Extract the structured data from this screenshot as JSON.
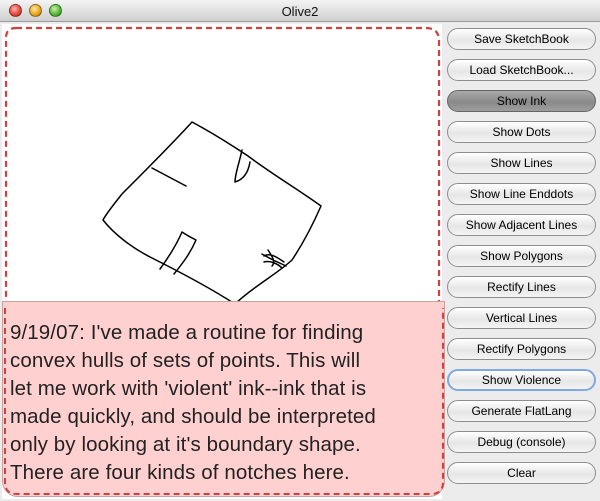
{
  "window": {
    "title": "Olive2"
  },
  "buttons": [
    {
      "label": "Save SketchBook",
      "name": "save-sketchbook-button",
      "state": "normal"
    },
    {
      "label": "Load SketchBook...",
      "name": "load-sketchbook-button",
      "state": "normal"
    },
    {
      "label": "Show Ink",
      "name": "show-ink-button",
      "state": "pressed"
    },
    {
      "label": "Show Dots",
      "name": "show-dots-button",
      "state": "normal"
    },
    {
      "label": "Show Lines",
      "name": "show-lines-button",
      "state": "normal"
    },
    {
      "label": "Show Line Enddots",
      "name": "show-line-enddots-button",
      "state": "normal"
    },
    {
      "label": "Show Adjacent Lines",
      "name": "show-adjacent-lines-button",
      "state": "normal"
    },
    {
      "label": "Show Polygons",
      "name": "show-polygons-button",
      "state": "normal"
    },
    {
      "label": "Rectify Lines",
      "name": "rectify-lines-button",
      "state": "normal"
    },
    {
      "label": "Vertical Lines",
      "name": "vertical-lines-button",
      "state": "normal"
    },
    {
      "label": "Rectify Polygons",
      "name": "rectify-polygons-button",
      "state": "normal"
    },
    {
      "label": "Show Violence",
      "name": "show-violence-button",
      "state": "focused"
    },
    {
      "label": "Generate FlatLang",
      "name": "generate-flatlang-button",
      "state": "normal"
    },
    {
      "label": "Debug (console)",
      "name": "debug-console-button",
      "state": "normal"
    },
    {
      "label": "Clear",
      "name": "clear-button",
      "state": "normal"
    }
  ],
  "note": {
    "lines": [
      "9/19/07: I've made a routine for finding",
      "convex hulls of sets of points. This will",
      "let me work with 'violent' ink--ink that is",
      "made quickly, and should be interpreted",
      "only by looking at it's boundary shape.",
      "There are four kinds of notches here."
    ]
  },
  "colors": {
    "selection_dash": "#d04040",
    "note_background": "#ffd0d0",
    "ink": "#000000"
  }
}
